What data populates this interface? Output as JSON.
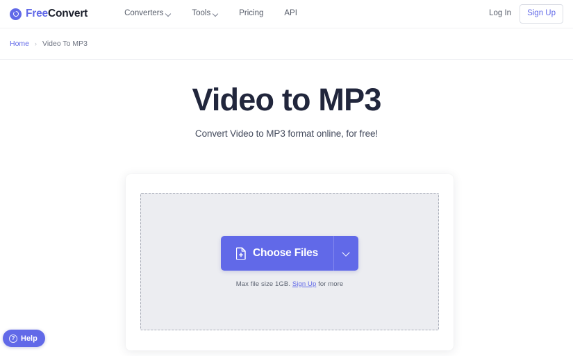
{
  "header": {
    "brand": {
      "part1": "Free",
      "part2": "Convert",
      "icon": "freeconvert-logo-icon"
    },
    "nav": [
      {
        "label": "Converters",
        "has_caret": true
      },
      {
        "label": "Tools",
        "has_caret": true
      },
      {
        "label": "Pricing",
        "has_caret": false
      },
      {
        "label": "API",
        "has_caret": false
      }
    ],
    "login_label": "Log In",
    "signup_label": "Sign Up"
  },
  "breadcrumb": {
    "home": "Home",
    "separator": "›",
    "current": "Video To MP3"
  },
  "hero": {
    "title": "Video to MP3",
    "subtitle": "Convert Video to MP3 format online, for free!"
  },
  "dropzone": {
    "choose_files_label": "Choose Files",
    "file_icon": "file-plus-icon",
    "dropdown_icon": "chevron-down-icon",
    "note_prefix": "Max file size 1GB.",
    "note_link": "Sign Up",
    "note_suffix": "for more"
  },
  "help": {
    "label": "Help",
    "icon": "question-circle-icon",
    "glyph": "?"
  },
  "colors": {
    "accent": "#6169e8",
    "title": "#21263c",
    "nav_text": "#555b68",
    "dropzone_bg": "#ecedf1",
    "dropzone_border": "#a9adb8",
    "page_bg": "#ffffff"
  }
}
